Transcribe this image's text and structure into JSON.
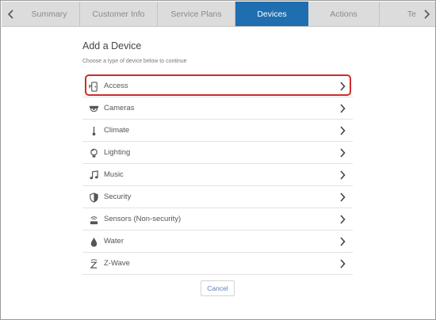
{
  "tabs": {
    "summary": "Summary",
    "customer_info": "Customer Info",
    "service_plans": "Service Plans",
    "devices": "Devices",
    "actions": "Actions",
    "overflow": "Te"
  },
  "page": {
    "title": "Add a Device",
    "subtitle": "Choose a type of device below to continue"
  },
  "devices": [
    {
      "label": "Access",
      "icon": "door-access-icon",
      "highlighted": true
    },
    {
      "label": "Cameras",
      "icon": "camera-icon"
    },
    {
      "label": "Climate",
      "icon": "thermometer-icon"
    },
    {
      "label": "Lighting",
      "icon": "light-bulb-icon"
    },
    {
      "label": "Music",
      "icon": "music-note-icon"
    },
    {
      "label": "Security",
      "icon": "shield-icon"
    },
    {
      "label": "Sensors (Non-security)",
      "icon": "sensor-icon"
    },
    {
      "label": "Water",
      "icon": "water-drop-icon"
    },
    {
      "label": "Z-Wave",
      "icon": "z-wave-icon"
    }
  ],
  "actions": {
    "cancel_label": "Cancel"
  },
  "colors": {
    "active_tab": "#1f6fb0",
    "highlight": "#d02b2b"
  }
}
